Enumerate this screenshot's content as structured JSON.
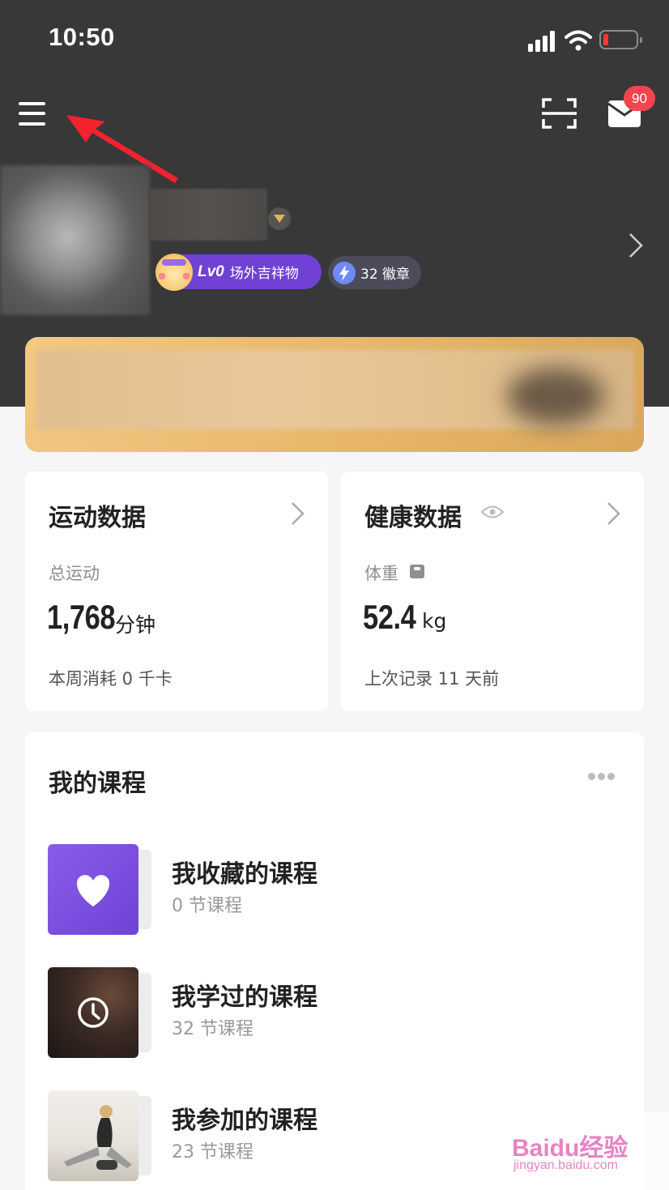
{
  "status_bar": {
    "time": "10:50"
  },
  "header": {
    "mail_badge_count": "90"
  },
  "profile": {
    "level_label": "Lv0",
    "level_name": "场外吉祥物",
    "badge_count_label": "32 徽章"
  },
  "sport_card": {
    "title": "运动数据",
    "label": "总运动",
    "value": "1,768",
    "unit": "分钟",
    "footer": "本周消耗 0 千卡"
  },
  "health_card": {
    "title": "健康数据",
    "label": "体重",
    "value": "52.4",
    "unit": "kg",
    "footer": "上次记录 11 天前"
  },
  "courses": {
    "title": "我的课程",
    "items": [
      {
        "name": "我收藏的课程",
        "count": "0 节课程",
        "icon": "heart-icon"
      },
      {
        "name": "我学过的课程",
        "count": "32 节课程",
        "icon": "clock-icon"
      },
      {
        "name": "我参加的课程",
        "count": "23 节课程",
        "icon": "photo"
      }
    ]
  },
  "watermark": {
    "text": "Baidu经验",
    "sub": "jingyan.baidu.com"
  },
  "colors": {
    "header_bg": "#383838",
    "badge_red": "#f4454f",
    "level_purple": "#7041d4",
    "gold": "#e7b66a"
  }
}
